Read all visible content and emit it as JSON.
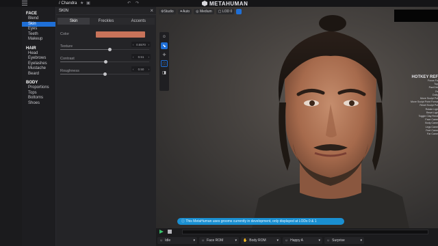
{
  "topbar": {
    "project_name": "Chandra",
    "brand": "METAHUMAN",
    "undo_icon": "undo-icon",
    "redo_icon": "redo-icon"
  },
  "leftnav": {
    "sections": [
      {
        "title": "FACE",
        "items": [
          "Blend",
          "Skin",
          "Eyes",
          "Teeth",
          "Makeup"
        ]
      },
      {
        "title": "HAIR",
        "items": [
          "Head",
          "Eyebrows",
          "Eyelashes",
          "Mustache",
          "Beard"
        ]
      },
      {
        "title": "BODY",
        "items": [
          "Proportions",
          "Tops",
          "Bottoms",
          "Shoes"
        ]
      }
    ],
    "active_item": "Skin"
  },
  "panel": {
    "title": "SKIN",
    "tabs": [
      "Skin",
      "Freckles",
      "Accents"
    ],
    "active_tab": "Skin",
    "color_label": "Color",
    "color_value": "#c8735a",
    "sliders": [
      {
        "label": "Texture",
        "value": "0.5570",
        "fraction": 0.557
      },
      {
        "label": "Contrast",
        "value": "0.51",
        "fraction": 0.51
      },
      {
        "label": "Roughness",
        "value": "0.50",
        "fraction": 0.5
      }
    ]
  },
  "viewport": {
    "toolbar": [
      "Studio",
      "Auto",
      "Medium",
      "LOD 0"
    ],
    "hotkeys_title": "HOTKEY REF",
    "hotkeys": [
      "Focus Fu",
      "Top",
      "Pan/Orb",
      "Zo",
      "Dolly",
      "Move Sculpt Poi",
      "Move Sculpt Point Forwa",
      "Reset Sculpt Poi",
      "Rotate Ligh",
      "Reset Ligh",
      "Toggle Clay Rend",
      "Face Came",
      "Body Came",
      "Legs Came",
      "Feet Came",
      "Far Came"
    ],
    "notice": "This MetaHuman uses grooms currently in development, only displayed at LODs 0 & 1"
  },
  "bottombar": {
    "animations": [
      "Idle",
      "Face ROM",
      "Body ROM",
      "Happy A",
      "Surprise"
    ]
  }
}
